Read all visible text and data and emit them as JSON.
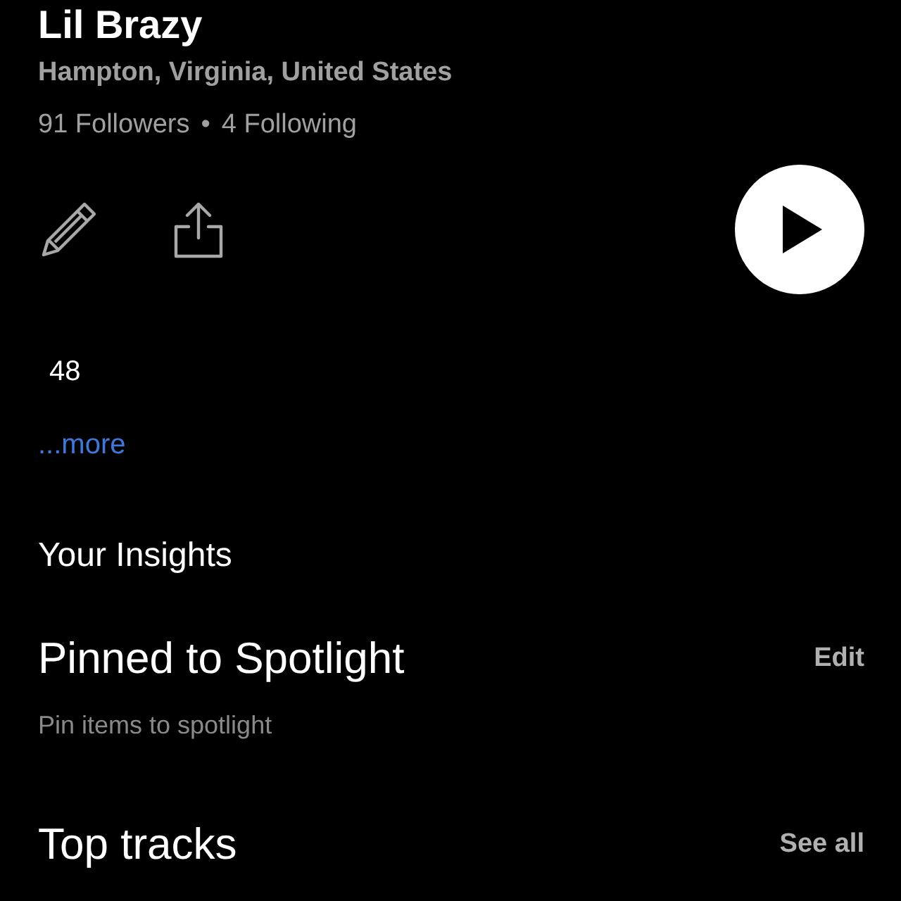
{
  "profile": {
    "name": "Lil Brazy",
    "location": "Hampton, Virginia, United States",
    "followers": "91 Followers",
    "separator": "•",
    "following": "4 Following"
  },
  "bio": {
    "text": "48",
    "more_link": "...more"
  },
  "insights": {
    "title": "Your Insights"
  },
  "sections": [
    {
      "title": "Pinned to Spotlight",
      "action": "Edit",
      "hint": "Pin items to spotlight"
    },
    {
      "title": "Top tracks",
      "action": "See all"
    }
  ]
}
